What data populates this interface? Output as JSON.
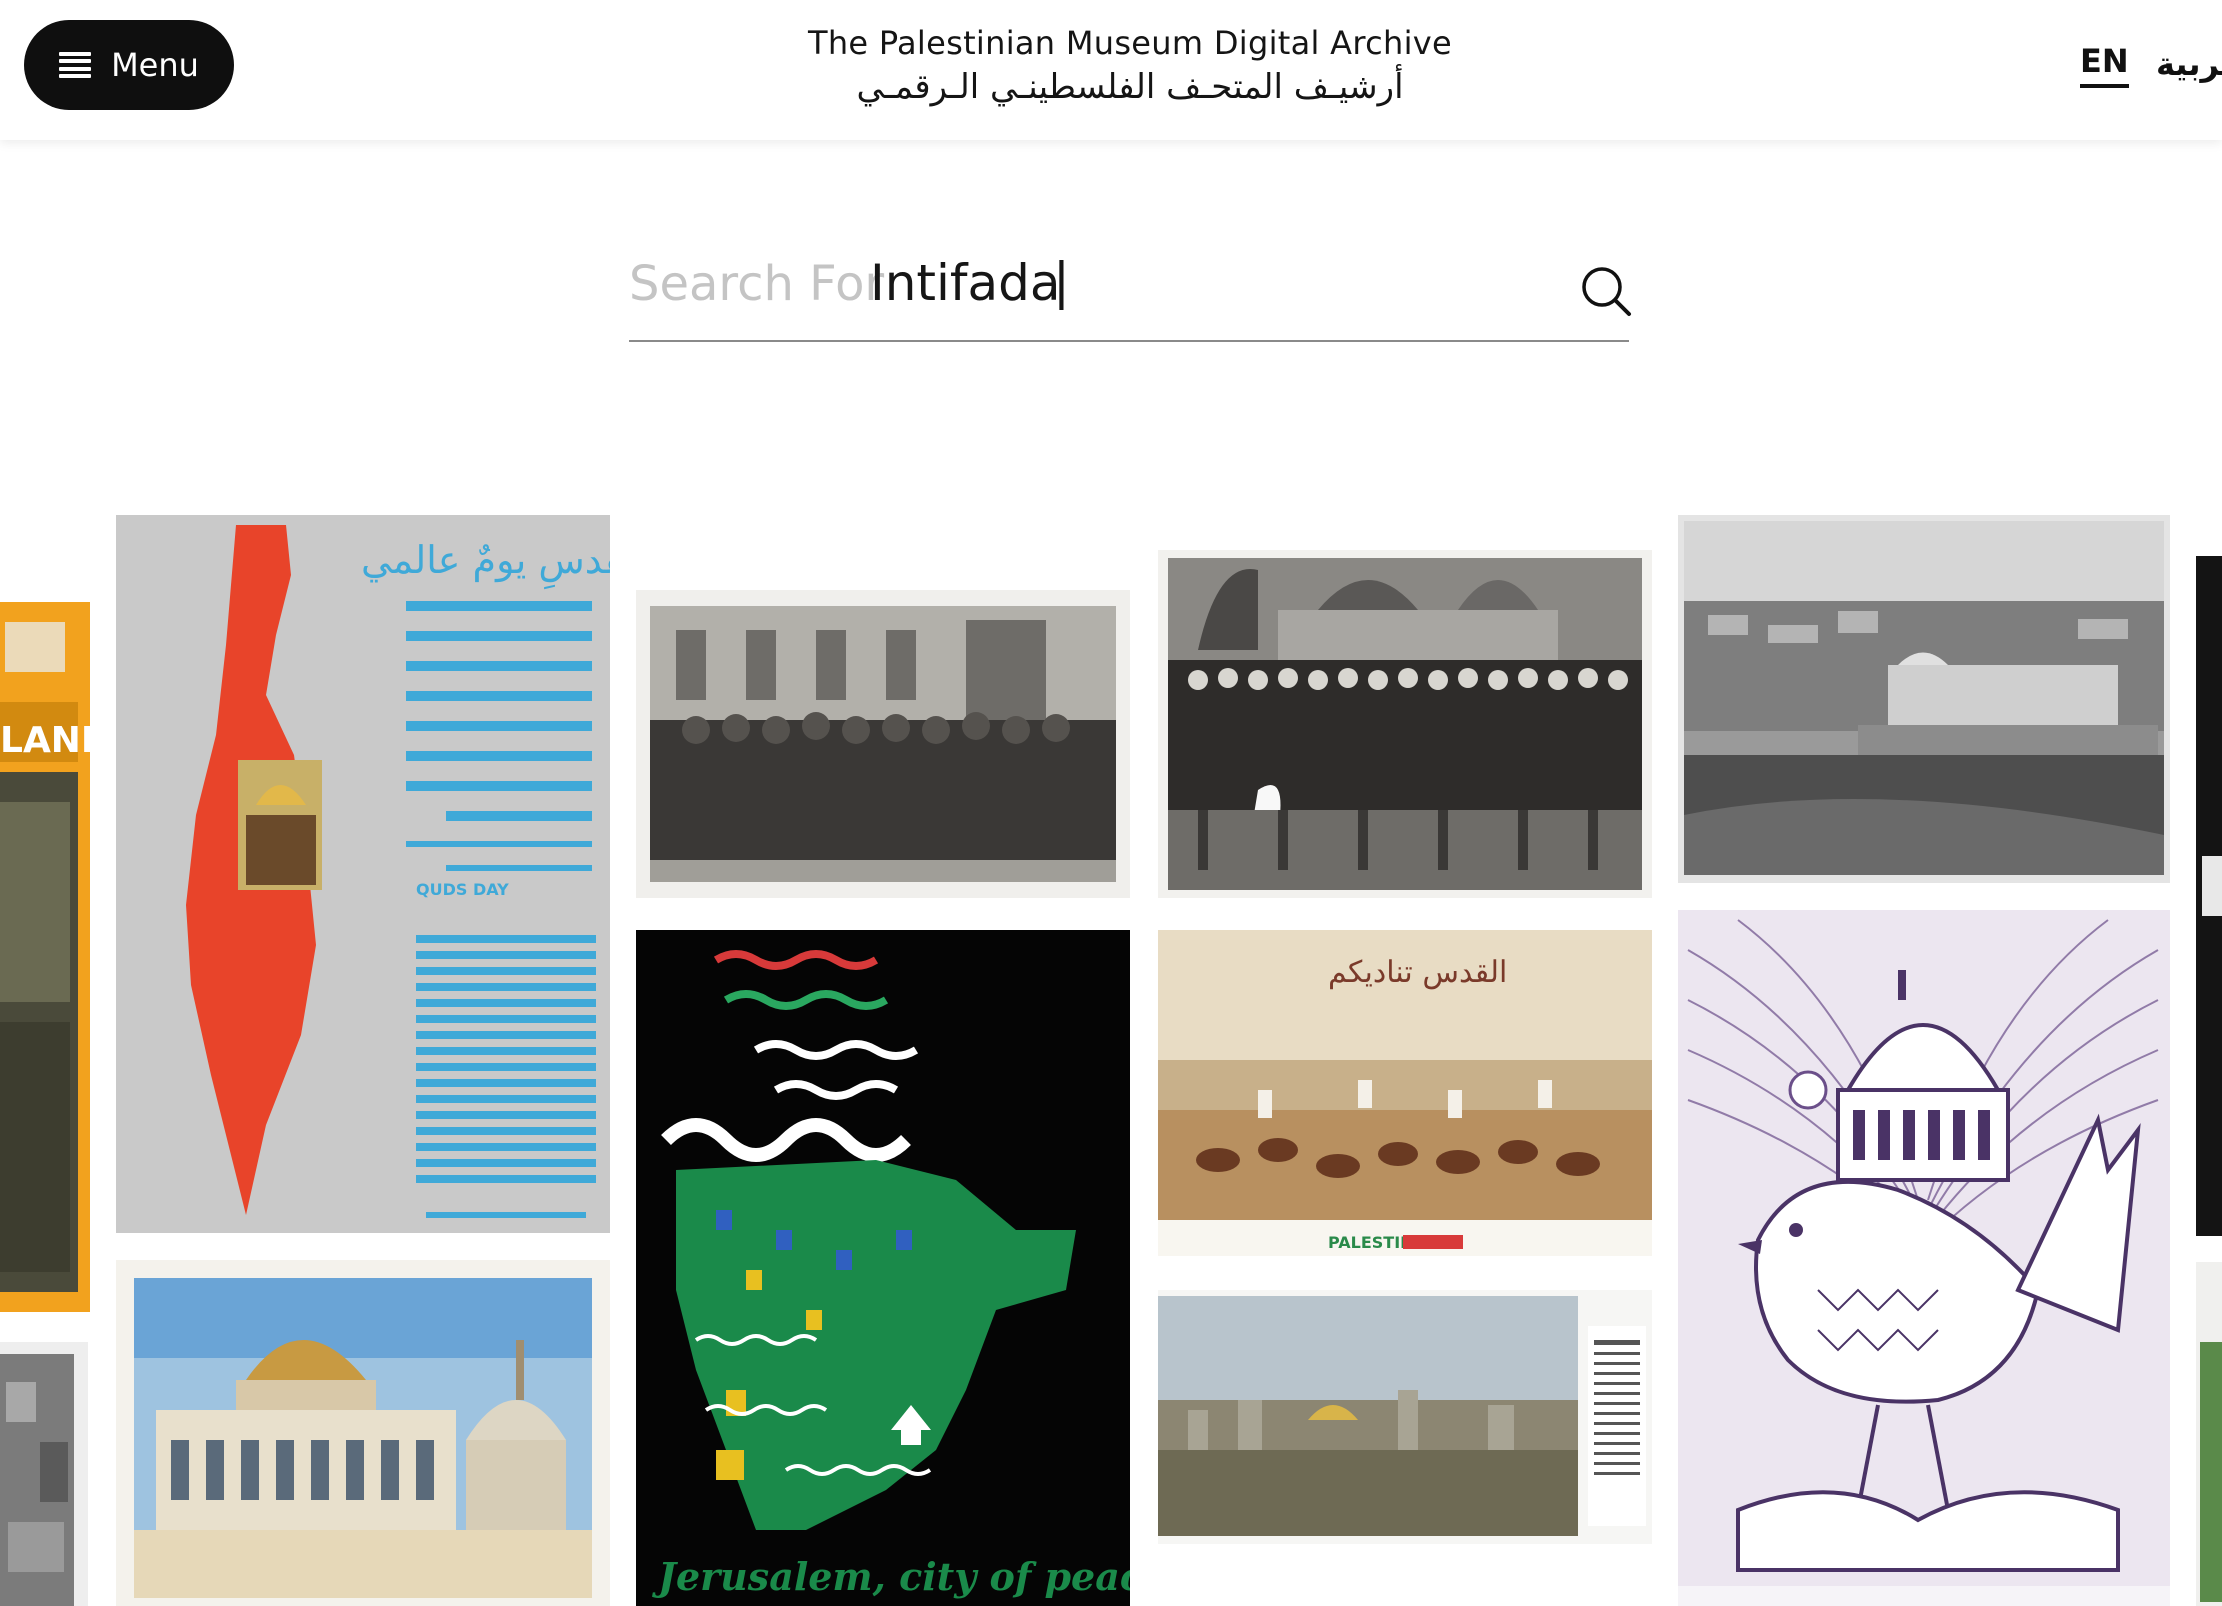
{
  "header": {
    "menu_label": "Menu",
    "title_en": "The Palestinian Museum Digital Archive",
    "title_ar": "أرشيـف المتحـف الفلسطينـي الـرقمـي",
    "lang_en": "EN",
    "lang_ar": "العربية"
  },
  "search": {
    "label": "Search For",
    "value": "Intifada",
    "cursor": "|"
  },
  "gallery": {
    "poster_quds_title": "يومُ القدسِ يومٌ عالمي",
    "poster_quds_en": "QUDS DAY (JERUSALEM DAY) IS A UNIVERSAL DAY.",
    "poster_peace_caption": "Jerusalem, city of peace",
    "poster_panorama_title": "القدس تناديكم",
    "poster_panorama_footer": "PALESTINE",
    "colors": {
      "poster_red": "#e8442a",
      "poster_blue_text": "#3fa9d8",
      "poster_orange": "#f2a21e",
      "poster_green": "#1a8a4a",
      "poster_purple": "#6b4f8a"
    }
  }
}
